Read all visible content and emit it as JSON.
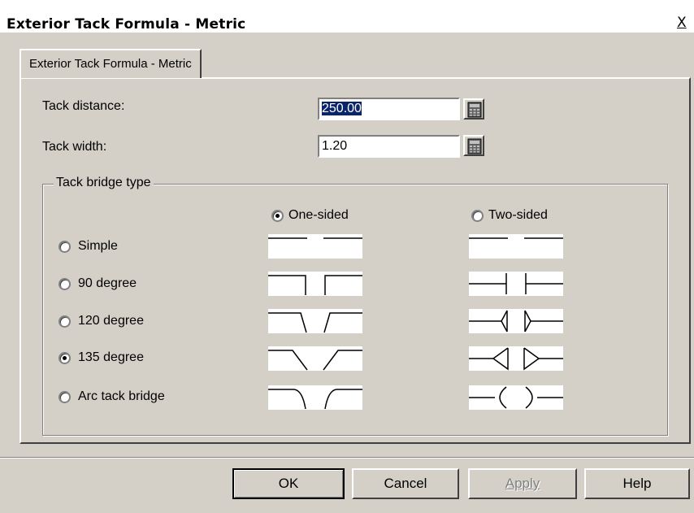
{
  "window": {
    "title": "Exterior Tack Formula - Metric",
    "close_glyph": "X"
  },
  "tab": {
    "label": "Exterior Tack Formula - Metric"
  },
  "fields": {
    "tack_distance": {
      "label": "Tack distance:",
      "value": "250.00",
      "icon": "calculator-icon"
    },
    "tack_width": {
      "label": "Tack width:",
      "value": "1.20",
      "icon": "calculator-icon"
    }
  },
  "bridge_type": {
    "group_label": "Tack bridge type",
    "sides": [
      {
        "label": "One-sided",
        "selected": true
      },
      {
        "label": "Two-sided",
        "selected": false
      }
    ],
    "options": [
      {
        "label": "Simple",
        "selected": false
      },
      {
        "label": "90 degree",
        "selected": false
      },
      {
        "label": "120 degree",
        "selected": false
      },
      {
        "label": "135 degree",
        "selected": true
      },
      {
        "label": "Arc tack bridge",
        "selected": false
      }
    ]
  },
  "buttons": {
    "ok": "OK",
    "cancel": "Cancel",
    "apply": "Apply",
    "help": "Help"
  }
}
